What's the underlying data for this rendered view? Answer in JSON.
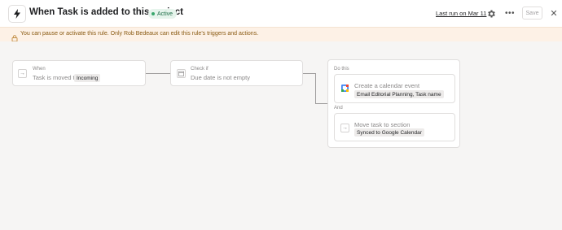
{
  "header": {
    "title": "When Task is added to this project",
    "status": "Active",
    "last_run": "Last run on Mar 11",
    "save_label": "Save",
    "icons": {
      "rule": "lightning-icon",
      "settings": "gear-icon",
      "more": "more-icon",
      "close": "close-icon"
    }
  },
  "banner": {
    "text": "You can pause or activate this rule. Only Rob Bedeaux can edit this rule's triggers and actions.",
    "icon": "lock-icon"
  },
  "trigger": {
    "label": "When",
    "text": "Task is moved to",
    "value": "Incoming",
    "icon": "arrow-right-icon"
  },
  "condition": {
    "label": "Check if",
    "text": "Due date is not empty",
    "icon": "calendar-icon"
  },
  "actions": {
    "label": "Do this",
    "and_label": "And",
    "items": [
      {
        "text": "Create a calendar event",
        "value": "Email Editorial Planning, Task name",
        "icon": "google-calendar-icon"
      },
      {
        "text": "Move task to section",
        "value": "Synced to Google Calendar",
        "icon": "arrow-right-icon"
      }
    ]
  },
  "colors": {
    "active_badge": "#e6f4ec",
    "banner_bg": "#fdf1e6",
    "banner_text": "#8a5a12",
    "canvas": "#f6f5f4"
  }
}
